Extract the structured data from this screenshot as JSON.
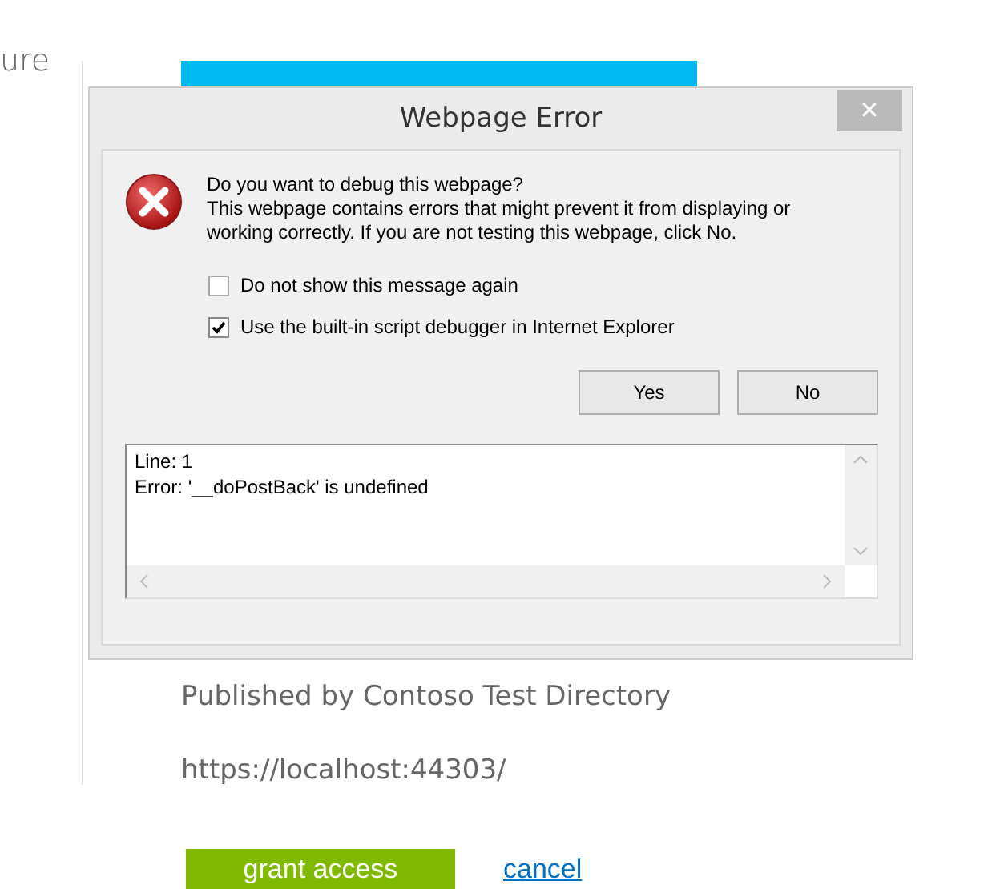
{
  "page": {
    "cut_heading": "ure",
    "publisher": "Published by Contoso Test Directory",
    "url": "https://localhost:44303/",
    "grant_button": "grant access",
    "cancel_link": "cancel"
  },
  "dialog": {
    "title": "Webpage Error",
    "close": "×",
    "question": "Do you want to debug this webpage?",
    "message": "This webpage contains errors that might prevent it from displaying or working correctly. If you are not testing this webpage, click No.",
    "options": [
      {
        "label": "Do not show this message again",
        "checked": false
      },
      {
        "label": "Use the built-in script debugger in Internet Explorer",
        "checked": true
      }
    ],
    "buttons": [
      "Yes",
      "No"
    ],
    "details": [
      "Line: 1",
      "Error: '__doPostBack' is undefined"
    ]
  }
}
